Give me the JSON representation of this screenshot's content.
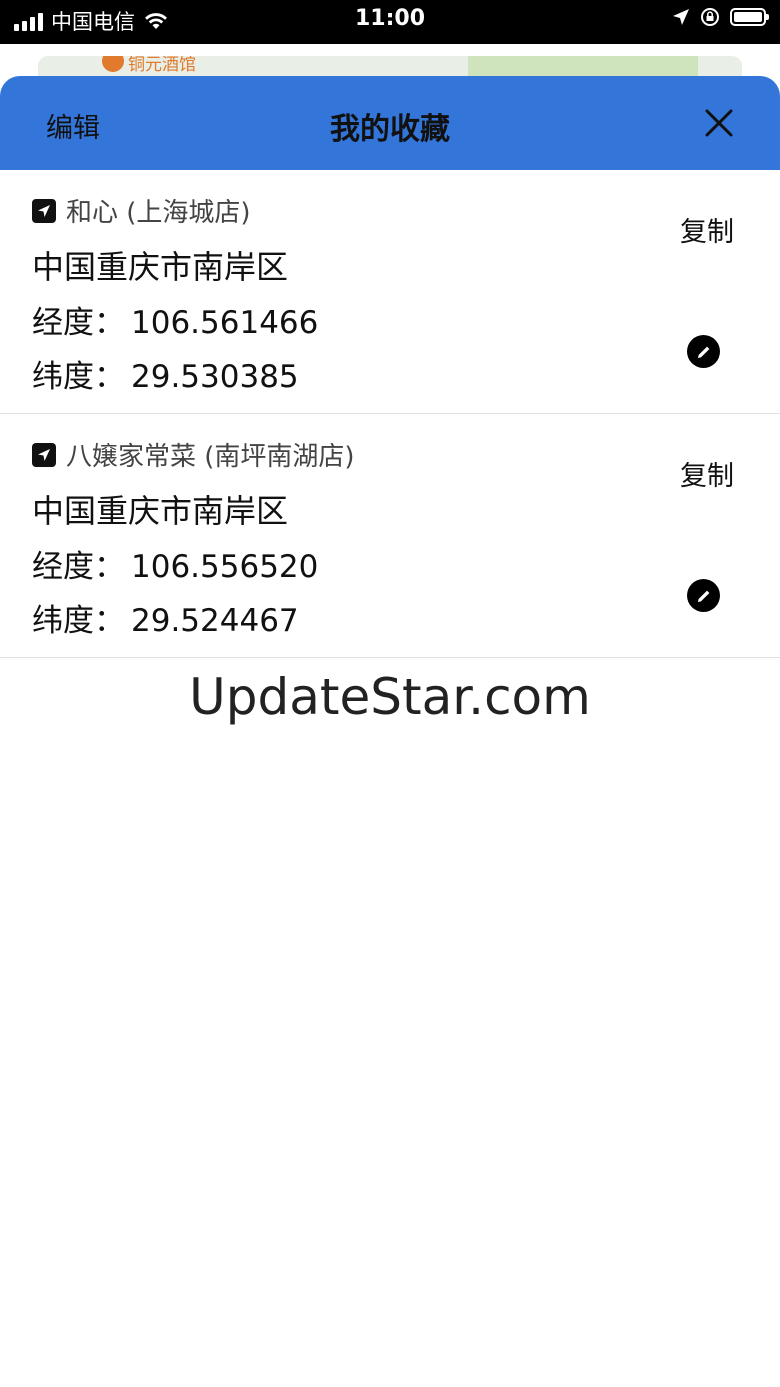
{
  "status_bar": {
    "carrier": "中国电信",
    "time": "11:00"
  },
  "background_map": {
    "poi_label": "铜元酒馆"
  },
  "header": {
    "edit_label": "编辑",
    "title": "我的收藏",
    "close_icon": "close-icon"
  },
  "favorites": [
    {
      "name": "和心 (上海城店)",
      "address": "中国重庆市南岸区",
      "lng_label": "经度：",
      "lng": "106.561466",
      "lat_label": "纬度：",
      "lat": "29.530385",
      "copy_label": "复制"
    },
    {
      "name": "八嬢家常菜 (南坪南湖店)",
      "address": "中国重庆市南岸区",
      "lng_label": "经度：",
      "lng": "106.556520",
      "lat_label": "纬度：",
      "lat": "29.524467",
      "copy_label": "复制"
    }
  ],
  "watermark": "UpdateStar.com",
  "colors": {
    "header_bg": "#3375d8",
    "status_bar_bg": "#000000"
  }
}
